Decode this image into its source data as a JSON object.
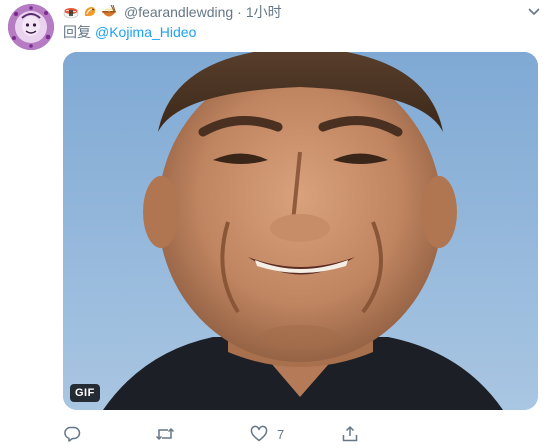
{
  "tweet": {
    "handle": "@fearandlewding",
    "separator": "·",
    "time": "1小时",
    "emojis": [
      "sushi-emoji",
      "shrimp-emoji",
      "noodle-bowl-emoji"
    ],
    "reply_prefix": "回复",
    "reply_to": "@Kojima_Hideo",
    "media": {
      "kind": "gif",
      "badge": "GIF",
      "subject": "smiling-man-face"
    },
    "actions": {
      "reply_count": "",
      "retweet_count": "",
      "like_count": "7",
      "share_count": ""
    }
  },
  "colors": {
    "link": "#1da1f2",
    "muted": "#657786",
    "text": "#14171a",
    "sky": "#8fb4d6"
  }
}
